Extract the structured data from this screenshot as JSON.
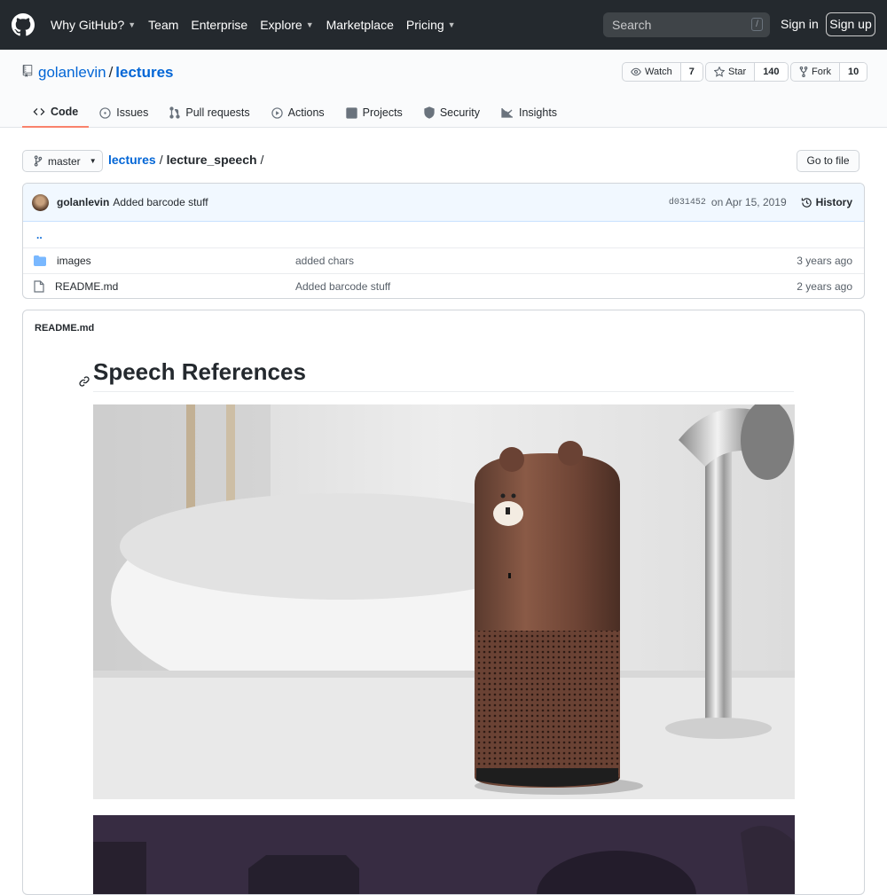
{
  "header": {
    "nav": [
      {
        "label": "Why GitHub?",
        "caret": true
      },
      {
        "label": "Team",
        "caret": false
      },
      {
        "label": "Enterprise",
        "caret": false
      },
      {
        "label": "Explore",
        "caret": true
      },
      {
        "label": "Marketplace",
        "caret": false
      },
      {
        "label": "Pricing",
        "caret": true
      }
    ],
    "search_placeholder": "Search",
    "search_hotkey": "/",
    "signin": "Sign in",
    "signup": "Sign up"
  },
  "repo": {
    "owner": "golanlevin",
    "separator": "/",
    "name": "lectures",
    "watch_label": "Watch",
    "watch_count": "7",
    "star_label": "Star",
    "star_count": "140",
    "fork_label": "Fork",
    "fork_count": "10",
    "tabs": [
      {
        "label": "Code",
        "icon": "code-icon",
        "selected": true
      },
      {
        "label": "Issues",
        "icon": "issue-icon"
      },
      {
        "label": "Pull requests",
        "icon": "pull-request-icon"
      },
      {
        "label": "Actions",
        "icon": "play-icon"
      },
      {
        "label": "Projects",
        "icon": "project-icon"
      },
      {
        "label": "Security",
        "icon": "shield-icon"
      },
      {
        "label": "Insights",
        "icon": "graph-icon"
      }
    ]
  },
  "filenav": {
    "branch": "master",
    "crumb_root": "lectures",
    "crumb_sep": "/",
    "crumb_dir": "lecture_speech",
    "crumb_trail": "/",
    "goto_file": "Go to file"
  },
  "commit": {
    "author": "golanlevin",
    "message": "Added barcode stuff",
    "sha": "d031452",
    "date": "on Apr 15, 2019",
    "history": "History"
  },
  "files": {
    "parent": "..",
    "rows": [
      {
        "name": "images",
        "type": "folder",
        "message": "added chars",
        "age": "3 years ago"
      },
      {
        "name": "README.md",
        "type": "file",
        "message": "Added barcode stuff",
        "age": "2 years ago"
      }
    ]
  },
  "readme": {
    "filename": "README.md",
    "heading": "Speech References"
  },
  "colors": {
    "header_bg": "#24292e",
    "link": "#0366d6",
    "tab_underline": "#f9826c",
    "commit_bg": "#f1f8ff"
  }
}
